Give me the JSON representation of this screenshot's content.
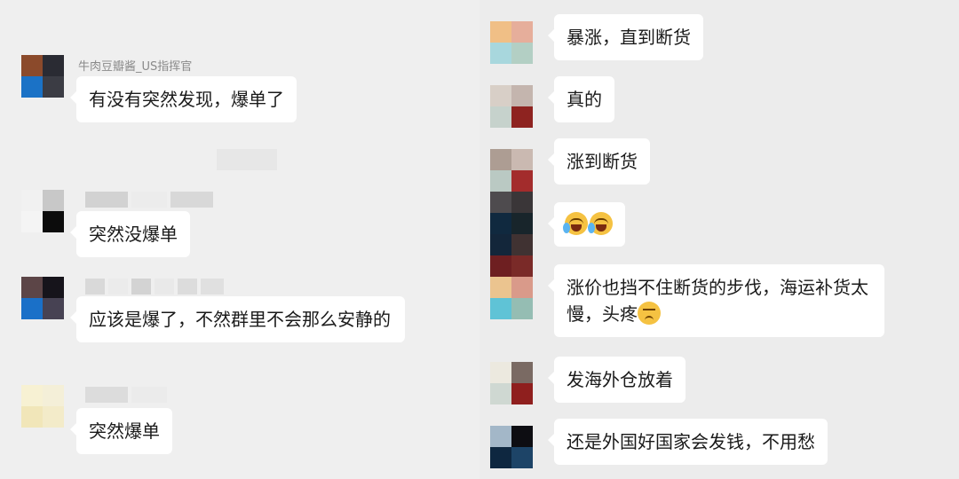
{
  "left_chat": {
    "messages": [
      {
        "sender": "牛肉豆瓣酱_US指挥官",
        "text": "有没有突然发现，爆单了"
      },
      {
        "sender": "",
        "text": "突然没爆单"
      },
      {
        "sender": "",
        "text": "应该是爆了，不然群里不会那么安静的"
      },
      {
        "sender": "",
        "text": "突然爆单"
      }
    ]
  },
  "right_chat": {
    "messages": [
      {
        "text": "暴涨，直到断货"
      },
      {
        "text": "真的"
      },
      {
        "text": "涨到断货"
      },
      {
        "text": "",
        "emojis": [
          "face-with-tears-icon",
          "face-with-tears-icon"
        ]
      },
      {
        "text": "涨价也挡不住断货的步伐，海运补货太慢，头疼",
        "emoji": "persevering-face-icon"
      },
      {
        "text": "发海外仓放着"
      },
      {
        "text": "还是外国好国家会发钱，不用愁"
      }
    ]
  },
  "colors": {
    "bubble": "#ffffff",
    "background": "#efefef",
    "text": "#1a1a1a",
    "sender": "#8a8a8a"
  }
}
